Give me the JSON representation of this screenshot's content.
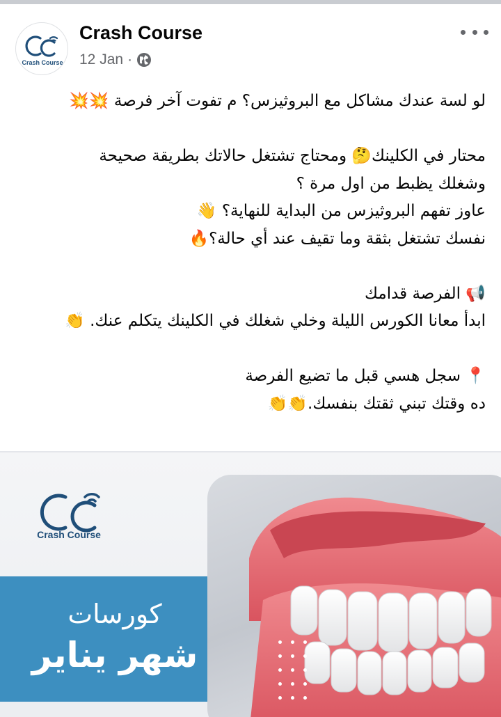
{
  "post": {
    "page_name": "Crash Course",
    "avatar_logo_text": "Crash Course",
    "date": "12 Jan",
    "separator": "·",
    "lines": [
      "لو لسة عندك مشاكل مع البروثيزس؟ م تفوت آخر فرصة 💥💥",
      "",
      "محتار في الكلينك🤔 ومحتاج تشتغل حالاتك بطريقة صحيحة",
      "وشغلك يظبط من اول مرة ؟",
      "عاوز تفهم البروثيزس من البداية للنهاية؟ 👋",
      "نفسك تشتغل بثقة وما تقيف عند أي حالة؟🔥",
      "",
      "📢 الفرصة قدامك",
      "ابدأ معانا الكورس الليلة وخلي شغلك في الكلينك يتكلم عنك. 👏",
      "",
      "📍 سجل هسي قبل ما تضيع الفرصة",
      "ده وقتك تبني ثقتك بنفسك.👏👏"
    ]
  },
  "image": {
    "logo_text": "Crash Course",
    "banner_title": "كورسات",
    "banner_subtitle": "شهر يناير"
  },
  "colors": {
    "brand_blue": "#1f4e79",
    "band_blue": "#3d8fc0",
    "gum_pink": "#e8707a",
    "meta_gray": "#65676b"
  },
  "icons": {
    "more": "more-horizontal-icon",
    "audience": "globe-icon"
  }
}
